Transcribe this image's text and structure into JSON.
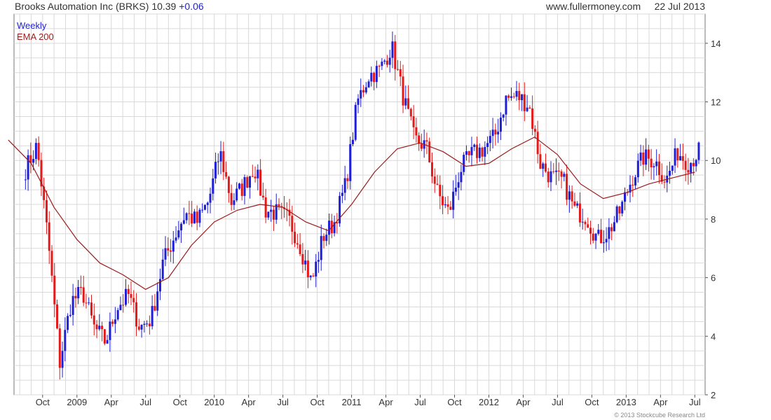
{
  "header": {
    "name": "Brooks Automation Inc (BRKS)",
    "price": "10.39",
    "change": "+0.06",
    "source": "www.fullermoney.com",
    "date": "22 Jul 2013"
  },
  "legend": {
    "period": "Weekly",
    "indicator": "EMA 200"
  },
  "copyright": "© 2013 Stockcube Research Ltd",
  "colors": {
    "up": "#1f1fd6",
    "down": "#e41a1a",
    "ema": "#9a1c1c",
    "grid": "#d9d9d9"
  },
  "chart_data": {
    "type": "candlestick",
    "title": "Brooks Automation Inc (BRKS)",
    "x_ticks": [
      "Oct",
      "2009",
      "Apr",
      "Jul",
      "Oct",
      "2010",
      "Apr",
      "Jul",
      "Oct",
      "2011",
      "Apr",
      "Jul",
      "Oct",
      "2012",
      "Apr",
      "Jul",
      "Oct",
      "2013",
      "Apr",
      "Jul"
    ],
    "y_ticks": [
      "2",
      "4",
      "6",
      "8",
      "10",
      "12",
      "14"
    ],
    "ylim": [
      2,
      15
    ],
    "y_axis_side": "right",
    "grid": true,
    "legend_position": "top-left",
    "series": [
      {
        "name": "Weekly",
        "kind": "price",
        "points": [
          {
            "x": "2008-08",
            "y": 9.7
          },
          {
            "x": "2008-09",
            "y": 10.5
          },
          {
            "x": "2008-10",
            "y": 7.2
          },
          {
            "x": "2008-11",
            "y": 3.1
          },
          {
            "x": "2008-12",
            "y": 5.2
          },
          {
            "x": "2009-01",
            "y": 5.5
          },
          {
            "x": "2009-02",
            "y": 4.3
          },
          {
            "x": "2009-03",
            "y": 3.8
          },
          {
            "x": "2009-04",
            "y": 5.0
          },
          {
            "x": "2009-05",
            "y": 5.4
          },
          {
            "x": "2009-06",
            "y": 4.3
          },
          {
            "x": "2009-07",
            "y": 4.6
          },
          {
            "x": "2009-08",
            "y": 6.5
          },
          {
            "x": "2009-09",
            "y": 7.4
          },
          {
            "x": "2009-10",
            "y": 8.2
          },
          {
            "x": "2009-11",
            "y": 7.9
          },
          {
            "x": "2009-12",
            "y": 8.6
          },
          {
            "x": "2010-01",
            "y": 10.3
          },
          {
            "x": "2010-02",
            "y": 8.6
          },
          {
            "x": "2010-03",
            "y": 9.1
          },
          {
            "x": "2010-04",
            "y": 9.8
          },
          {
            "x": "2010-05",
            "y": 8.3
          },
          {
            "x": "2010-06",
            "y": 8.2
          },
          {
            "x": "2010-07",
            "y": 8.0
          },
          {
            "x": "2010-08",
            "y": 7.1
          },
          {
            "x": "2010-09",
            "y": 5.8
          },
          {
            "x": "2010-10",
            "y": 7.4
          },
          {
            "x": "2010-11",
            "y": 7.9
          },
          {
            "x": "2010-12",
            "y": 9.2
          },
          {
            "x": "2011-01",
            "y": 12.0
          },
          {
            "x": "2011-02",
            "y": 12.9
          },
          {
            "x": "2011-03",
            "y": 13.1
          },
          {
            "x": "2011-04",
            "y": 13.9
          },
          {
            "x": "2011-05",
            "y": 12.2
          },
          {
            "x": "2011-06",
            "y": 10.7
          },
          {
            "x": "2011-07",
            "y": 10.5
          },
          {
            "x": "2011-08",
            "y": 8.9
          },
          {
            "x": "2011-09",
            "y": 8.2
          },
          {
            "x": "2011-10",
            "y": 9.7
          },
          {
            "x": "2011-11",
            "y": 10.2
          },
          {
            "x": "2011-12",
            "y": 10.4
          },
          {
            "x": "2012-01",
            "y": 10.8
          },
          {
            "x": "2012-02",
            "y": 12.1
          },
          {
            "x": "2012-03",
            "y": 12.2
          },
          {
            "x": "2012-04",
            "y": 11.9
          },
          {
            "x": "2012-05",
            "y": 9.9
          },
          {
            "x": "2012-06",
            "y": 9.4
          },
          {
            "x": "2012-07",
            "y": 9.3
          },
          {
            "x": "2012-08",
            "y": 8.3
          },
          {
            "x": "2012-09",
            "y": 8.1
          },
          {
            "x": "2012-10",
            "y": 7.3
          },
          {
            "x": "2012-11",
            "y": 7.6
          },
          {
            "x": "2012-12",
            "y": 8.3
          },
          {
            "x": "2013-01",
            "y": 9.4
          },
          {
            "x": "2013-02",
            "y": 10.1
          },
          {
            "x": "2013-03",
            "y": 10.0
          },
          {
            "x": "2013-04",
            "y": 9.3
          },
          {
            "x": "2013-05",
            "y": 10.3
          },
          {
            "x": "2013-06",
            "y": 9.9
          },
          {
            "x": "2013-07",
            "y": 10.39
          }
        ]
      },
      {
        "name": "EMA 200",
        "kind": "ema",
        "points": [
          {
            "x": "2008-07",
            "y": 10.7
          },
          {
            "x": "2008-09",
            "y": 9.9
          },
          {
            "x": "2008-11",
            "y": 8.4
          },
          {
            "x": "2009-01",
            "y": 7.3
          },
          {
            "x": "2009-03",
            "y": 6.5
          },
          {
            "x": "2009-05",
            "y": 6.1
          },
          {
            "x": "2009-07",
            "y": 5.6
          },
          {
            "x": "2009-09",
            "y": 6.0
          },
          {
            "x": "2009-11",
            "y": 7.1
          },
          {
            "x": "2010-01",
            "y": 7.9
          },
          {
            "x": "2010-03",
            "y": 8.3
          },
          {
            "x": "2010-05",
            "y": 8.5
          },
          {
            "x": "2010-07",
            "y": 8.4
          },
          {
            "x": "2010-09",
            "y": 7.9
          },
          {
            "x": "2010-11",
            "y": 7.6
          },
          {
            "x": "2011-01",
            "y": 8.5
          },
          {
            "x": "2011-03",
            "y": 9.6
          },
          {
            "x": "2011-05",
            "y": 10.4
          },
          {
            "x": "2011-07",
            "y": 10.6
          },
          {
            "x": "2011-09",
            "y": 10.3
          },
          {
            "x": "2011-11",
            "y": 9.8
          },
          {
            "x": "2012-01",
            "y": 9.9
          },
          {
            "x": "2012-03",
            "y": 10.4
          },
          {
            "x": "2012-05",
            "y": 10.8
          },
          {
            "x": "2012-07",
            "y": 10.2
          },
          {
            "x": "2012-09",
            "y": 9.2
          },
          {
            "x": "2012-11",
            "y": 8.7
          },
          {
            "x": "2013-01",
            "y": 8.9
          },
          {
            "x": "2013-03",
            "y": 9.2
          },
          {
            "x": "2013-05",
            "y": 9.4
          },
          {
            "x": "2013-07",
            "y": 9.6
          }
        ]
      }
    ]
  }
}
